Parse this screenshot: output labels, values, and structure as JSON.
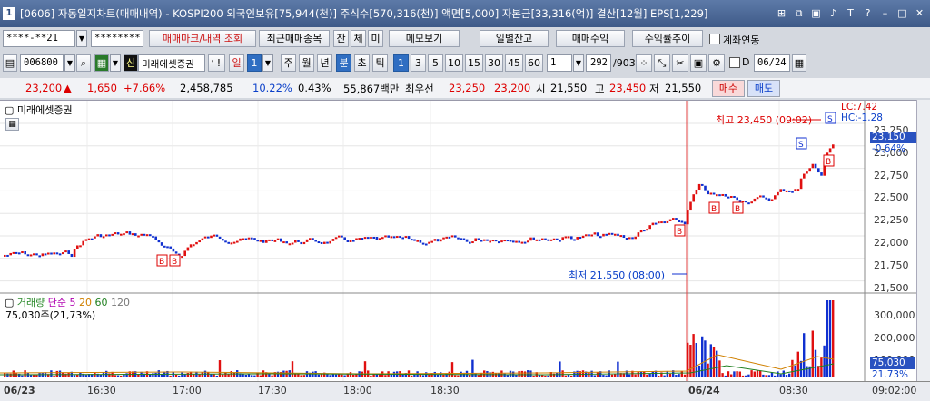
{
  "window": {
    "number": "1",
    "title": "[0606] 자동일지차트(매매내역) - KOSPI200 외국인보유[75,944(천)] 주식수[570,316(천)] 액면[5,000] 자본금[33,316(억)] 결산[12월] EPS[1,229]"
  },
  "toolbar1": {
    "account": "****-**21",
    "password": "********",
    "trade_mark_btn": "매매마크/내역 조회",
    "recent_btn": "최근매매종목",
    "btn_jan": "잔",
    "btn_che": "체",
    "btn_mi": "미",
    "memo_btn": "메모보기",
    "daily_btn": "일별잔고",
    "profit_btn": "매매수익",
    "rate_btn": "수익률추이",
    "link_label": "계좌연동"
  },
  "toolbar2": {
    "code": "006800",
    "credit_tag": "신",
    "stock_name": "미래에셋증권",
    "excl": "!",
    "period_il": "일",
    "period_value": "1",
    "btn_ju": "주",
    "btn_wol": "월",
    "btn_nyeon": "년",
    "btn_bun": "분",
    "btn_cho": "초",
    "btn_tik": "틱",
    "intervals": [
      "1",
      "3",
      "5",
      "10",
      "15",
      "30",
      "45",
      "60"
    ],
    "count": "1",
    "pages": "292",
    "pages_total": "/903",
    "d_label": "D",
    "date": "06/24"
  },
  "quote": {
    "price": "23,200",
    "change_arrow": "▲",
    "change": "1,650",
    "change_pct": "+7.66%",
    "volume": "2,458,785",
    "vol_pct": "10.22%",
    "turnover": "0.43%",
    "amount": "55,867백만",
    "best_label": "최우선",
    "ask": "23,250",
    "bid": "23,200",
    "open_label": "시",
    "open": "21,550",
    "high_label": "고",
    "high": "23,450",
    "low_label": "저",
    "low": "21,550",
    "buy_btn": "매수",
    "sell_btn": "매도"
  },
  "price_chart": {
    "legend": "미래에셋증권",
    "lc": "LC:7.42",
    "hc": "HC:-1.28",
    "high_note": "최고 23,450 (09:02)",
    "low_note": "최저 21,550 (08:00)",
    "yticks": [
      "23,250",
      "23,000",
      "22,750",
      "22,500",
      "22,250",
      "22,000",
      "21,750",
      "21,500"
    ],
    "current": "23,150",
    "current_pct": "-0.64%"
  },
  "volume_chart": {
    "label": "거래량",
    "ma_label": "단순",
    "ma": [
      "5",
      "20",
      "60",
      "120"
    ],
    "value": "75,030주(21,73%)",
    "yticks": [
      "300,000",
      "200,000",
      "100,000"
    ],
    "current": "75,030",
    "current_pct": "21.73%"
  },
  "time_axis": {
    "labels": [
      "06/23",
      "16:30",
      "17:00",
      "17:30",
      "18:00",
      "18:30",
      "06/24",
      "08:30"
    ],
    "right_time": "09:02:00"
  },
  "colors": {
    "up": "#e01010",
    "down": "#1030d0",
    "title": "#3e5a88",
    "buy": "#d00",
    "sell": "#0a3fc9"
  }
}
